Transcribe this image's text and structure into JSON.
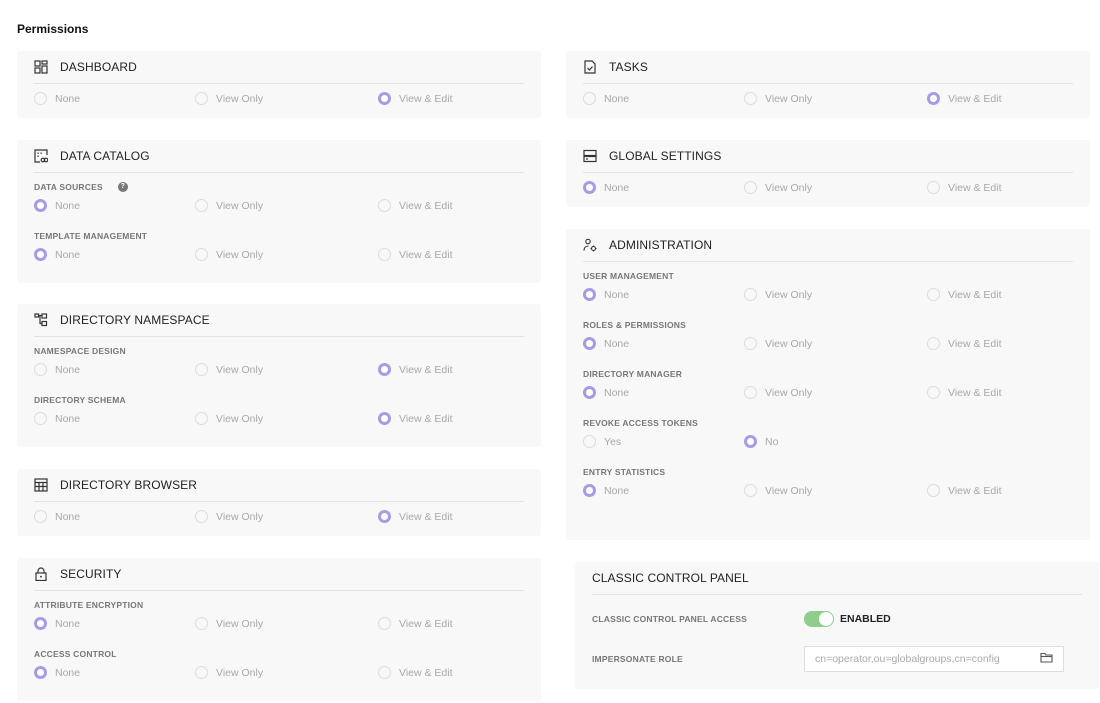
{
  "page": {
    "title": "Permissions"
  },
  "options3": [
    "None",
    "View Only",
    "View & Edit"
  ],
  "dashboard": {
    "title": "DASHBOARD",
    "icon": "dashboard-grid-icon",
    "options": [
      "None",
      "View Only",
      "View & Edit"
    ],
    "selected": "View & Edit"
  },
  "data_catalog": {
    "title": "DATA CATALOG",
    "icon": "data-catalog-icon",
    "groups": [
      {
        "label": "DATA SOURCES",
        "help": "?",
        "options": [
          "None",
          "View Only",
          "View & Edit"
        ],
        "selected": "None"
      },
      {
        "label": "TEMPLATE MANAGEMENT",
        "options": [
          "None",
          "View Only",
          "View & Edit"
        ],
        "selected": "None"
      }
    ]
  },
  "directory_namespace": {
    "title": "DIRECTORY NAMESPACE",
    "icon": "namespace-tree-icon",
    "groups": [
      {
        "label": "NAMESPACE DESIGN",
        "options": [
          "None",
          "View Only",
          "View & Edit"
        ],
        "selected": "View & Edit"
      },
      {
        "label": "DIRECTORY SCHEMA",
        "options": [
          "None",
          "View Only",
          "View & Edit"
        ],
        "selected": "View & Edit"
      }
    ]
  },
  "directory_browser": {
    "title": "DIRECTORY BROWSER",
    "icon": "table-icon",
    "options": [
      "None",
      "View Only",
      "View & Edit"
    ],
    "selected": "View & Edit"
  },
  "security": {
    "title": "SECURITY",
    "icon": "lock-icon",
    "groups": [
      {
        "label": "ATTRIBUTE ENCRYPTION",
        "options": [
          "None",
          "View Only",
          "View & Edit"
        ],
        "selected": "None"
      },
      {
        "label": "ACCESS CONTROL",
        "options": [
          "None",
          "View Only",
          "View & Edit"
        ],
        "selected": "None"
      }
    ]
  },
  "tasks": {
    "title": "TASKS",
    "icon": "task-document-icon",
    "options": [
      "None",
      "View Only",
      "View & Edit"
    ],
    "selected": "View & Edit"
  },
  "global_settings": {
    "title": "GLOBAL SETTINGS",
    "icon": "server-icon",
    "options": [
      "None",
      "View Only",
      "View & Edit"
    ],
    "selected": "None"
  },
  "administration": {
    "title": "ADMINISTRATION",
    "icon": "user-gear-icon",
    "groups": [
      {
        "label": "USER MANAGEMENT",
        "options": [
          "None",
          "View Only",
          "View & Edit"
        ],
        "selected": "None"
      },
      {
        "label": "ROLES & PERMISSIONS",
        "options": [
          "None",
          "View Only",
          "View & Edit"
        ],
        "selected": "None"
      },
      {
        "label": "DIRECTORY MANAGER",
        "options": [
          "None",
          "View Only",
          "View & Edit"
        ],
        "selected": "None"
      },
      {
        "label": "REVOKE ACCESS TOKENS",
        "options": [
          "Yes",
          "No"
        ],
        "selected": "No"
      },
      {
        "label": "ENTRY STATISTICS",
        "options": [
          "None",
          "View Only",
          "View & Edit"
        ],
        "selected": "None"
      }
    ]
  },
  "classic_control_panel": {
    "title": "CLASSIC CONTROL PANEL",
    "access_label": "CLASSIC CONTROL PANEL ACCESS",
    "access_enabled": true,
    "access_state_text": "ENABLED",
    "impersonate_label": "IMPERSONATE ROLE",
    "impersonate_placeholder": "cn=operator,ou=globalgroups,cn=config"
  },
  "colors": {
    "accent": "#a59ce6",
    "toggle_on": "#8fce8a",
    "card_bg": "#f8f8f8"
  }
}
